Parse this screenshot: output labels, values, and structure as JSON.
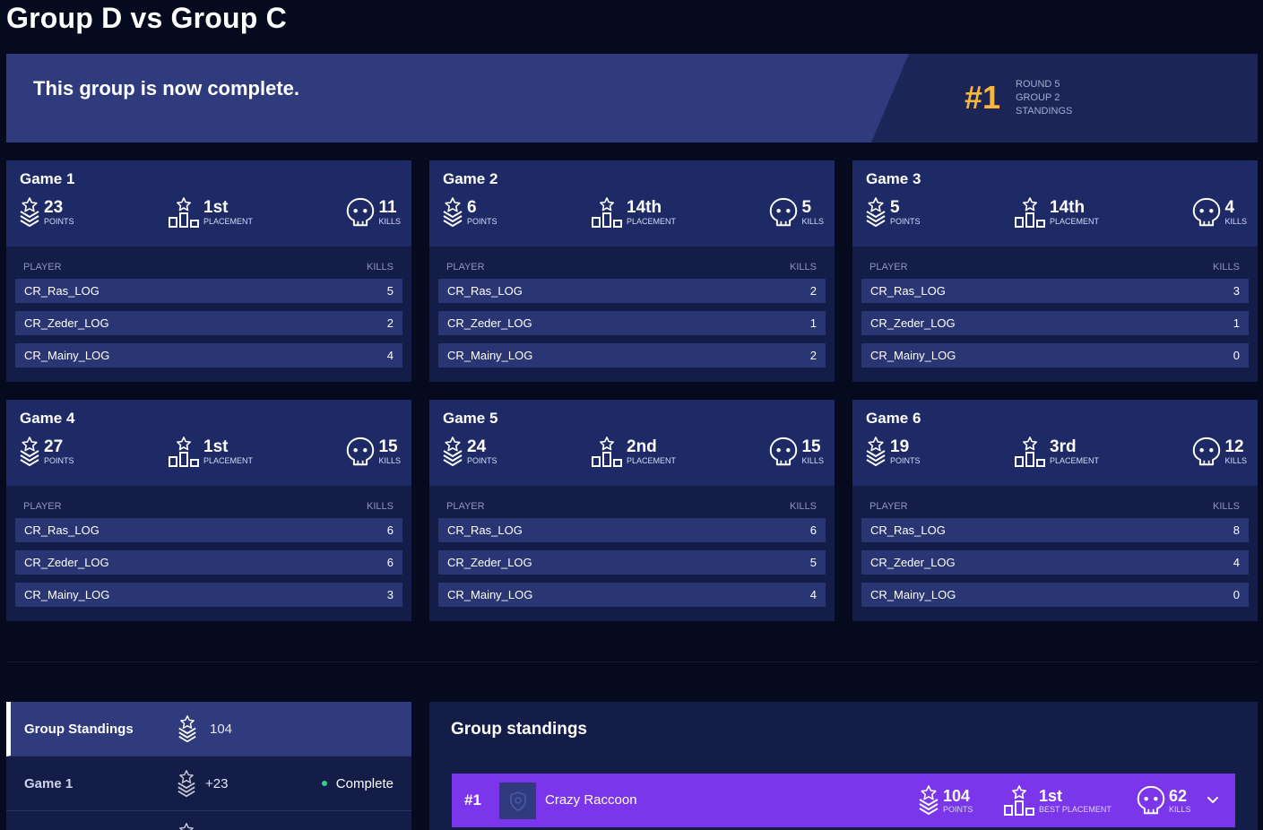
{
  "page_title": "Group D vs Group C",
  "banner": {
    "message": "This group is now complete.",
    "rank": "#1",
    "lines": [
      "ROUND 5",
      "GROUP 2",
      "STANDINGS"
    ]
  },
  "labels": {
    "points": "POINTS",
    "placement": "PLACEMENT",
    "kills": "KILLS",
    "player_col": "PLAYER",
    "kills_col": "KILLS",
    "best_placement": "BEST PLACEMENT"
  },
  "games": [
    {
      "title": "Game 1",
      "points": "23",
      "placement": "1st",
      "kills": "11",
      "players": [
        {
          "name": "CR_Ras_LOG",
          "kills": "5"
        },
        {
          "name": "CR_Zeder_LOG",
          "kills": "2"
        },
        {
          "name": "CR_Mainy_LOG",
          "kills": "4"
        }
      ]
    },
    {
      "title": "Game 2",
      "points": "6",
      "placement": "14th",
      "kills": "5",
      "players": [
        {
          "name": "CR_Ras_LOG",
          "kills": "2"
        },
        {
          "name": "CR_Zeder_LOG",
          "kills": "1"
        },
        {
          "name": "CR_Mainy_LOG",
          "kills": "2"
        }
      ]
    },
    {
      "title": "Game 3",
      "points": "5",
      "placement": "14th",
      "kills": "4",
      "players": [
        {
          "name": "CR_Ras_LOG",
          "kills": "3"
        },
        {
          "name": "CR_Zeder_LOG",
          "kills": "1"
        },
        {
          "name": "CR_Mainy_LOG",
          "kills": "0"
        }
      ]
    },
    {
      "title": "Game 4",
      "points": "27",
      "placement": "1st",
      "kills": "15",
      "players": [
        {
          "name": "CR_Ras_LOG",
          "kills": "6"
        },
        {
          "name": "CR_Zeder_LOG",
          "kills": "6"
        },
        {
          "name": "CR_Mainy_LOG",
          "kills": "3"
        }
      ]
    },
    {
      "title": "Game 5",
      "points": "24",
      "placement": "2nd",
      "kills": "15",
      "players": [
        {
          "name": "CR_Ras_LOG",
          "kills": "6"
        },
        {
          "name": "CR_Zeder_LOG",
          "kills": "5"
        },
        {
          "name": "CR_Mainy_LOG",
          "kills": "4"
        }
      ]
    },
    {
      "title": "Game 6",
      "points": "19",
      "placement": "3rd",
      "kills": "12",
      "players": [
        {
          "name": "CR_Ras_LOG",
          "kills": "8"
        },
        {
          "name": "CR_Zeder_LOG",
          "kills": "4"
        },
        {
          "name": "CR_Mainy_LOG",
          "kills": "0"
        }
      ]
    }
  ],
  "side_standings": {
    "title": "Group Standings",
    "total": "104",
    "rows": [
      {
        "label": "Game 1",
        "value": "+23",
        "status": "Complete"
      }
    ]
  },
  "group_standings": {
    "title": "Group standings",
    "teams": [
      {
        "rank": "#1",
        "name": "Crazy Raccoon",
        "points": "104",
        "best_placement": "1st",
        "kills": "62"
      }
    ]
  },
  "icons": {
    "points": "badge-star-icon",
    "placement": "podium-icon",
    "kills": "skull-icon",
    "expand": "chevron-down-icon",
    "team_logo": "shield-icon"
  },
  "colors": {
    "background": "#050a1f",
    "banner": "#2f3b7c",
    "card": "#141c48",
    "card_header": "#1e2a66",
    "row": "#2a3573",
    "accent_gold": "#f6b73c",
    "team_highlight": "#7b35ea",
    "status_green": "#2fd286"
  }
}
